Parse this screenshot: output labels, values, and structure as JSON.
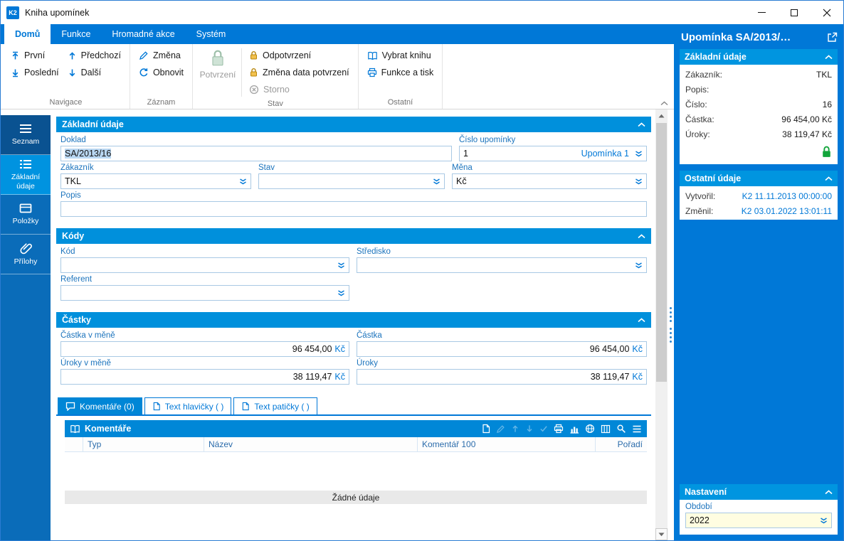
{
  "window": {
    "app_icon_text": "K2",
    "title": "Kniha upomínek"
  },
  "ribbon": {
    "tabs": [
      {
        "label": "Domů",
        "active": true
      },
      {
        "label": "Funkce"
      },
      {
        "label": "Hromadné akce"
      },
      {
        "label": "Systém"
      }
    ],
    "groups": [
      {
        "label": "Navigace",
        "buttons": [
          {
            "label": "První"
          },
          {
            "label": "Poslední"
          },
          {
            "label": "Předchozí"
          },
          {
            "label": "Další"
          }
        ]
      },
      {
        "label": "Záznam",
        "buttons": [
          {
            "label": "Změna"
          },
          {
            "label": "Obnovit"
          }
        ]
      },
      {
        "label": "Stav",
        "buttons": [
          {
            "label": "Potvrzení",
            "disabled": true
          },
          {
            "label": "Odpotvrzení"
          },
          {
            "label": "Změna data potvrzení"
          },
          {
            "label": "Storno",
            "disabled": true
          }
        ]
      },
      {
        "label": "Ostatní",
        "buttons": [
          {
            "label": "Vybrat knihu"
          },
          {
            "label": "Funkce a tisk"
          }
        ]
      }
    ]
  },
  "sidebar": {
    "items": [
      {
        "label": "Seznam"
      },
      {
        "label": "Základní údaje",
        "active": true
      },
      {
        "label": "Položky"
      },
      {
        "label": "Přílohy"
      }
    ]
  },
  "main": {
    "zakladni": {
      "title": "Základní údaje",
      "doklad_label": "Doklad",
      "doklad_value": "SA/2013/16",
      "cislo_label": "Číslo upomínky",
      "cislo_value": "1",
      "cislo_suffix": "Upomínka 1",
      "zakaznik_label": "Zákazník",
      "zakaznik_value": "TKL",
      "stav_label": "Stav",
      "stav_value": "",
      "mena_label": "Měna",
      "mena_value": "Kč",
      "popis_label": "Popis",
      "popis_value": ""
    },
    "kody": {
      "title": "Kódy",
      "kod_label": "Kód",
      "stredisko_label": "Středisko",
      "referent_label": "Referent"
    },
    "castky": {
      "title": "Částky",
      "currency": "Kč",
      "castka_mene_label": "Částka v měně",
      "castka_mene_value": "96 454,00",
      "castka_label": "Částka",
      "castka_value": "96 454,00",
      "uroky_mene_label": "Úroky v měně",
      "uroky_mene_value": "38 119,47",
      "uroky_label": "Úroky",
      "uroky_value": "38 119,47"
    },
    "tabs": [
      {
        "label": "Komentáře (0)",
        "active": true
      },
      {
        "label": "Text hlavičky ( )"
      },
      {
        "label": "Text patičky ( )"
      }
    ],
    "grid": {
      "title": "Komentáře",
      "columns": [
        "Typ",
        "Název",
        "Komentář 100",
        "Pořadí"
      ],
      "empty_text": "Žádné údaje"
    }
  },
  "right_panel": {
    "title": "Upomínka SA/2013/…",
    "zakladni": {
      "title": "Základní údaje",
      "rows": [
        {
          "label": "Zákazník:",
          "value": "TKL"
        },
        {
          "label": "Popis:",
          "value": ""
        },
        {
          "label": "Číslo:",
          "value": "16"
        },
        {
          "label": "Částka:",
          "value": "96 454,00 Kč"
        },
        {
          "label": "Úroky:",
          "value": "38 119,47 Kč"
        }
      ]
    },
    "ostatni": {
      "title": "Ostatní údaje",
      "rows": [
        {
          "label": "Vytvořil:",
          "value": "K2 11.11.2013 00:00:00"
        },
        {
          "label": "Změnil:",
          "value": "K2 03.01.2022 13:01:11"
        }
      ]
    },
    "nastaveni": {
      "title": "Nastavení",
      "obdobi_label": "Období",
      "obdobi_value": "2022"
    }
  },
  "colors": {
    "accent": "#0078d7",
    "section_header": "#0090dc",
    "panel_header": "#0095e0",
    "lock_green": "#12a53b",
    "period_field_bg": "#fffde1"
  }
}
